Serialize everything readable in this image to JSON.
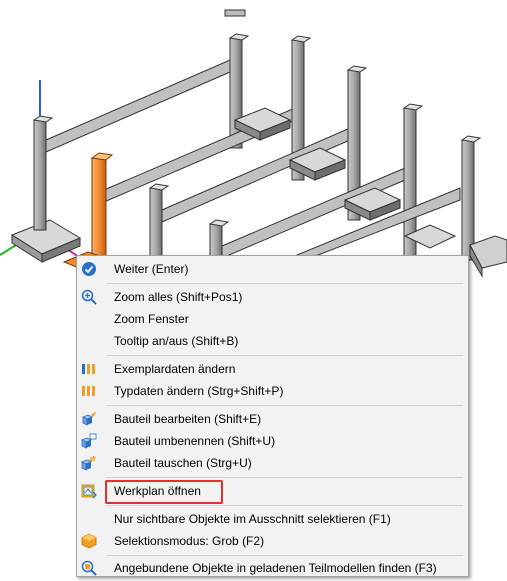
{
  "context_menu": {
    "items": [
      {
        "label": "Weiter (Enter)",
        "icon": "check-circle-icon"
      },
      {
        "label": "Zoom alles (Shift+Pos1)",
        "icon": "zoom-all-icon"
      },
      {
        "label": "Zoom Fenster",
        "icon": ""
      },
      {
        "label": "Tooltip an/aus (Shift+B)",
        "icon": ""
      },
      {
        "label": "Exemplardaten ändern",
        "icon": "instance-data-icon"
      },
      {
        "label": "Typdaten ändern (Strg+Shift+P)",
        "icon": "type-data-icon"
      },
      {
        "label": "Bauteil bearbeiten (Shift+E)",
        "icon": "edit-component-icon"
      },
      {
        "label": "Bauteil umbenennen (Shift+U)",
        "icon": "rename-component-icon"
      },
      {
        "label": "Bauteil tauschen (Strg+U)",
        "icon": "swap-component-icon"
      },
      {
        "label": "Werkplan öffnen",
        "icon": "open-plan-icon"
      },
      {
        "label": "Nur sichtbare Objekte im Ausschnitt selektieren (F1)",
        "icon": ""
      },
      {
        "label": "Selektionsmodus: Grob (F2)",
        "icon": "selection-mode-icon"
      },
      {
        "label": "Angebundene Objekte in geladenen Teilmodellen finden (F3)",
        "icon": "find-linked-icon"
      }
    ]
  },
  "colors": {
    "highlight": "#e03030",
    "selected_column": "#f08a30",
    "axis_y": "#3060e0",
    "axis_x": "#20b020",
    "axis_z": "#d020a0"
  }
}
